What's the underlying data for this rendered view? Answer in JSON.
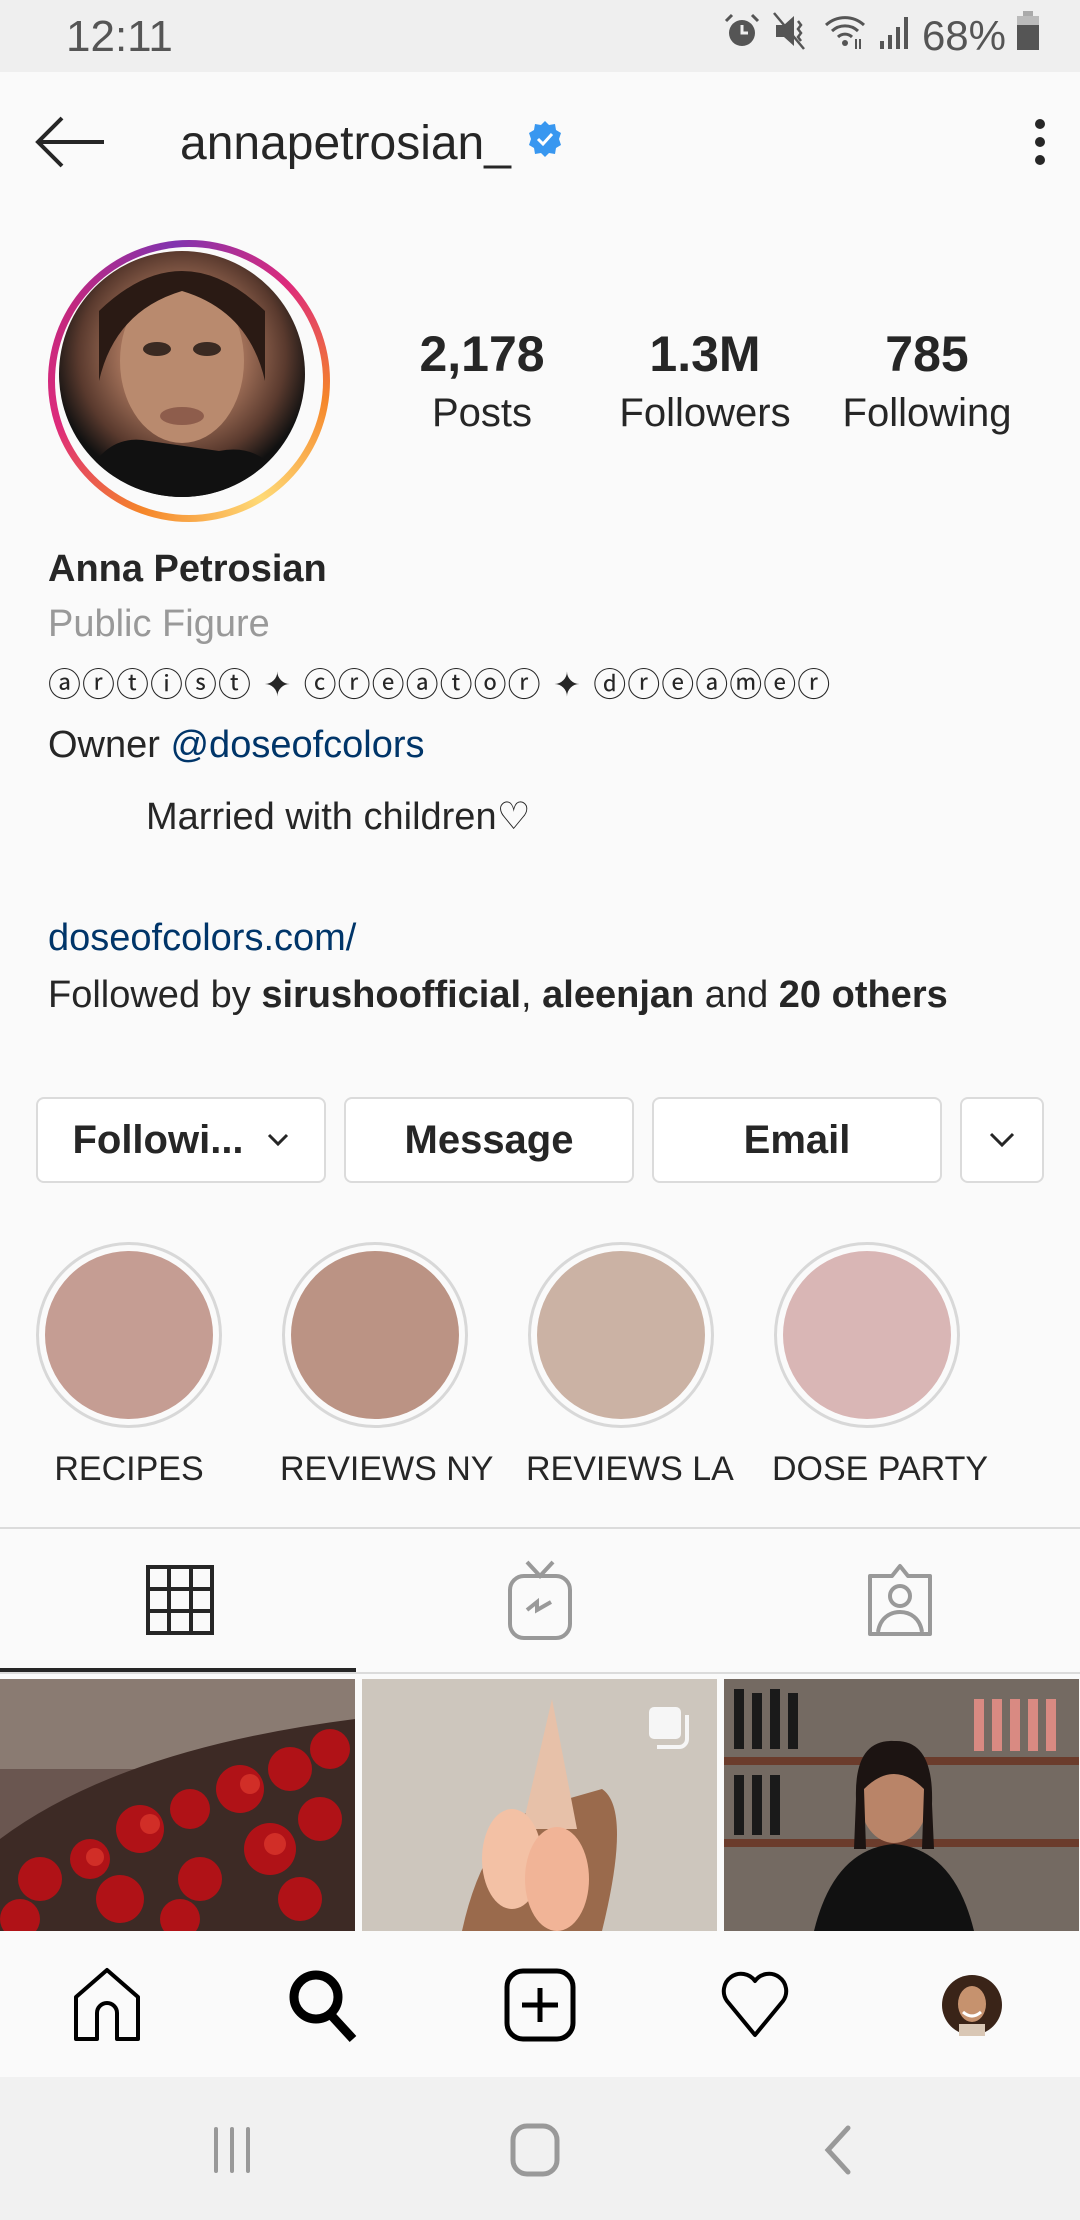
{
  "status_bar": {
    "time": "12:11",
    "battery": "68%",
    "icons": [
      "alarm-icon",
      "mute-icon",
      "wifi-icon",
      "signal-icon",
      "battery-icon"
    ]
  },
  "header": {
    "username": "annapetrosian_",
    "verified": true,
    "back_icon": "back-arrow-icon",
    "menu_icon": "more-vertical-icon"
  },
  "profile": {
    "stats": [
      {
        "value": "2,178",
        "label": "Posts"
      },
      {
        "value": "1.3M",
        "label": "Followers"
      },
      {
        "value": "785",
        "label": "Following"
      }
    ],
    "name": "Anna Petrosian",
    "category": "Public Figure",
    "bio_line1": "ⓐⓡⓣⓘⓢⓣ ✦ ⓒⓡⓔⓐⓣⓞⓡ ✦ ⓓⓡⓔⓐⓜⓔⓡ",
    "bio_owner_prefix": "Owner ",
    "bio_owner_mention": "@doseofcolors",
    "bio_line3": "Married with children♡",
    "website": "doseofcolors.com/",
    "followed_by": {
      "prefix": "Followed by ",
      "user1": "sirushoofficial",
      "sep": ", ",
      "user2": "aleenjan",
      "mid": " and ",
      "others": "20 others"
    }
  },
  "actions": {
    "following_label": "Followi...",
    "message_label": "Message",
    "email_label": "Email"
  },
  "highlights": [
    {
      "label": "RECIPES",
      "color": "#c59d93"
    },
    {
      "label": "REVIEWS NY",
      "color": "#bb9384"
    },
    {
      "label": "REVIEWS LA",
      "color": "#cbb2a4"
    },
    {
      "label": "DOSE PARTY",
      "color": "#d9b6b5"
    }
  ],
  "tabs": [
    {
      "name": "grid",
      "icon": "grid-icon",
      "active": true
    },
    {
      "name": "igtv",
      "icon": "igtv-icon",
      "active": false
    },
    {
      "name": "tagged",
      "icon": "tagged-icon",
      "active": false
    }
  ],
  "posts": [
    {
      "description": "red flowers table setting",
      "multi": false
    },
    {
      "description": "hand holding makeup sponges",
      "multi": true
    },
    {
      "description": "woman in wine shop",
      "multi": false
    }
  ],
  "bottom_nav": [
    "home-icon",
    "search-icon",
    "add-post-icon",
    "activity-heart-icon",
    "profile-avatar"
  ],
  "system_nav": [
    "recents-icon",
    "home-button-icon",
    "back-icon"
  ]
}
